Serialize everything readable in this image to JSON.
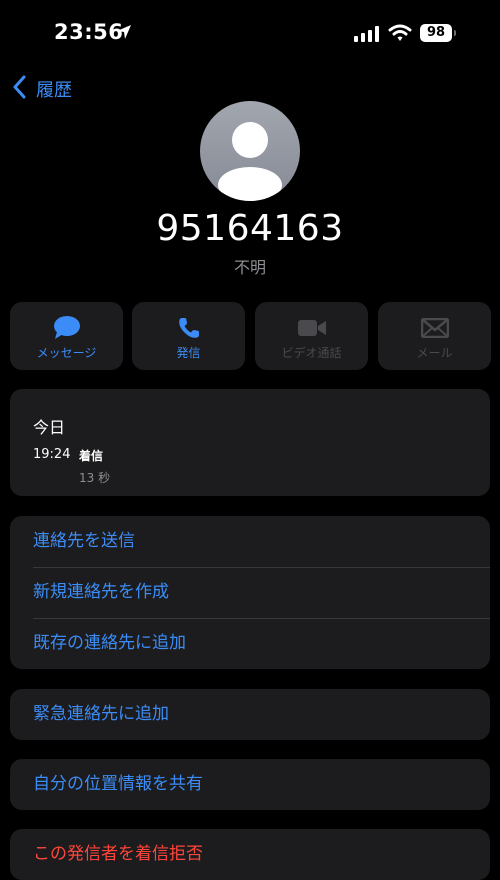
{
  "status_bar": {
    "time": "23:56",
    "battery": "98"
  },
  "nav": {
    "back_label": "履歴"
  },
  "contact": {
    "number": "95164163",
    "label": "不明"
  },
  "actions": [
    {
      "label": "メッセージ",
      "icon": "message-icon",
      "enabled": true
    },
    {
      "label": "発信",
      "icon": "phone-icon",
      "enabled": true
    },
    {
      "label": "ビデオ通話",
      "icon": "video-icon",
      "enabled": false
    },
    {
      "label": "メール",
      "icon": "mail-icon",
      "enabled": false
    }
  ],
  "history": {
    "title": "今日",
    "entries": [
      {
        "time": "19:24",
        "type": "着信",
        "duration": "13 秒"
      }
    ]
  },
  "contact_actions": {
    "send_contact": "連絡先を送信",
    "create_new": "新規連絡先を作成",
    "add_existing": "既存の連絡先に追加"
  },
  "emergency": {
    "add": "緊急連絡先に追加"
  },
  "location": {
    "share": "自分の位置情報を共有"
  },
  "block": {
    "label": "この発信者を着信拒否"
  },
  "colors": {
    "accent": "#3b8cf6",
    "danger": "#ff453a",
    "card": "#1c1c1e",
    "background": "#000000",
    "secondary_text": "#8e8e93",
    "disabled": "#4a4a4e"
  }
}
